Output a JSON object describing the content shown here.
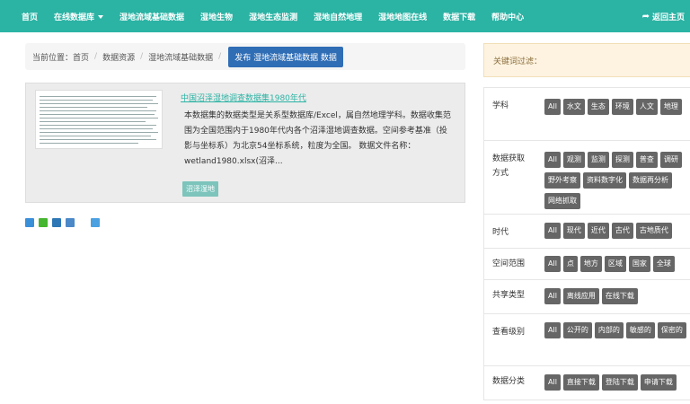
{
  "nav": {
    "items": [
      "首页",
      "在线数据库",
      "湿地流域基础数据",
      "湿地生物",
      "湿地生态监测",
      "湿地自然地理",
      "湿地地图在线",
      "数据下载",
      "帮助中心"
    ],
    "return_label": "返回主页"
  },
  "breadcrumb": {
    "prefix": "当前位置：",
    "items": [
      "首页",
      "数据资源",
      "湿地流域基础数据"
    ],
    "button_label": "发布 湿地流域基础数据 数据"
  },
  "result": {
    "title": "中国沼泽湿地调查数据集1980年代",
    "description": "本数据集的数据类型是关系型数据库/Excel，属自然地理学科。数据收集范围为全国范围内于1980年代内各个沼泽湿地调查数据。空间参考基准（投影与坐标系）为北京54坐标系统，粒度为全国。 数据文件名称：wetland1980.xlsx(沼泽...",
    "tag": "沼泽湿地"
  },
  "share_icons": [
    "plus-share-icon",
    "wechat-icon",
    "linkedin-icon",
    "mail-icon",
    "qq-icon"
  ],
  "filter": {
    "heading": "关键词过滤：",
    "groups": [
      {
        "label": "学科",
        "options": [
          "All",
          "水文",
          "生态",
          "环境",
          "人文",
          "地理"
        ]
      },
      {
        "label": "数据获取方式",
        "options": [
          "All",
          "观测",
          "监测",
          "探测",
          "普查",
          "调研",
          "野外考察",
          "资料数字化",
          "数据再分析",
          "网络抓取"
        ]
      },
      {
        "label": "时代",
        "options": [
          "All",
          "现代",
          "近代",
          "古代",
          "古地质代"
        ]
      },
      {
        "label": "空间范围",
        "options": [
          "All",
          "点",
          "地方",
          "区域",
          "国家",
          "全球"
        ]
      },
      {
        "label": "共享类型",
        "options": [
          "All",
          "离线应用",
          "在线下载"
        ]
      },
      {
        "label": "查看级别",
        "options": [
          "All",
          "公开的",
          "内部的",
          "敏感的",
          "保密的"
        ]
      },
      {
        "label": "数据分类",
        "options": [
          "All",
          "直接下载",
          "登陆下载",
          "申请下载"
        ]
      }
    ]
  },
  "colors": {
    "nav_bg": "#2bb3a4",
    "link": "#2bb3a4",
    "primary_button": "#2f6db5",
    "filter_button": "#666666"
  }
}
